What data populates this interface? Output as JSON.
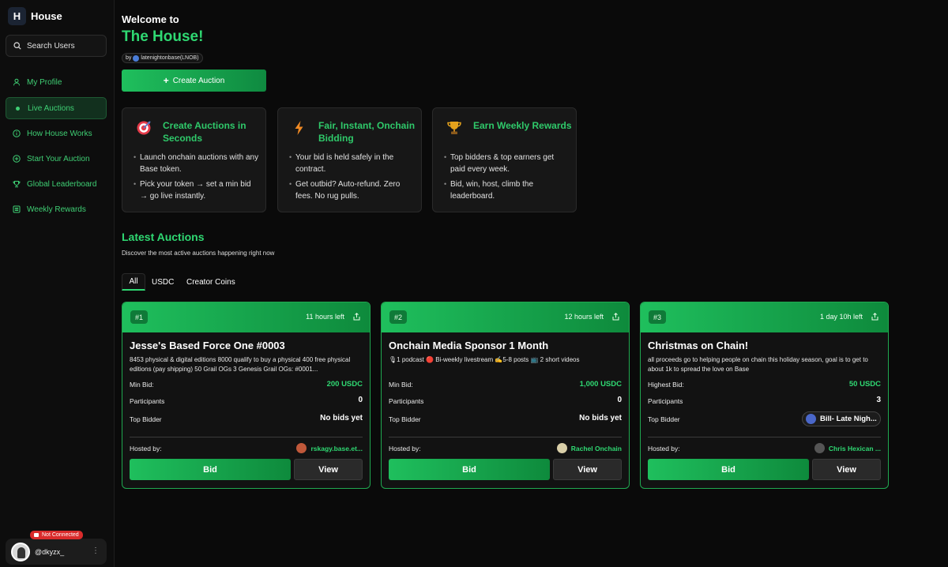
{
  "app": {
    "logo_letter": "H",
    "name": "House"
  },
  "sidebar": {
    "search_label": "Search Users",
    "items": [
      {
        "label": "My Profile",
        "icon": "user-icon"
      },
      {
        "label": "Live Auctions",
        "icon": "live-dot-icon",
        "active": true
      },
      {
        "label": "How House Works",
        "icon": "info-icon"
      },
      {
        "label": "Start Your Auction",
        "icon": "plus-circle-icon"
      },
      {
        "label": "Global Leaderboard",
        "icon": "trophy-icon"
      },
      {
        "label": "Weekly Rewards",
        "icon": "list-icon"
      }
    ],
    "status_badge": "Not Connected",
    "user_handle": "@dkyzx_"
  },
  "hero": {
    "welcome": "Welcome to",
    "title": "The House!",
    "by_prefix": "by",
    "by_name": "latenightonbase(LNOB)",
    "create_button": "Create Auction"
  },
  "features": [
    {
      "icon": "target-icon",
      "title": "Create Auctions in Seconds",
      "bullets": [
        "Launch onchain auctions with any Base token.",
        "Pick your token → set a min bid → go live instantly."
      ]
    },
    {
      "icon": "lightning-icon",
      "title": "Fair, Instant, Onchain Bidding",
      "bullets": [
        "Your bid is held safely in the contract.",
        "Get outbid? Auto-refund. Zero fees. No rug pulls."
      ]
    },
    {
      "icon": "trophy-icon",
      "title": "Earn Weekly Rewards",
      "bullets": [
        "Top bidders & top earners get paid every week.",
        "Bid, win, host, climb the leaderboard."
      ]
    }
  ],
  "latest": {
    "title": "Latest Auctions",
    "subtitle": "Discover the most active auctions happening right now",
    "tabs": [
      "All",
      "USDC",
      "Creator Coins"
    ]
  },
  "labels": {
    "participants": "Participants",
    "top_bidder": "Top Bidder",
    "hosted_by": "Hosted by:",
    "bid": "Bid",
    "view": "View"
  },
  "auctions": [
    {
      "rank": "#1",
      "time_left": "11 hours left",
      "title": "Jesse's Based Force One #0003",
      "description": "8453 physical & digital editions 8000 qualify to buy a physical 400 free physical editions (pay shipping) 50 Grail OGs 3 Genesis Grail OGs: #0001...",
      "bid_label": "Min Bid:",
      "bid_value": "200 USDC",
      "participants": "0",
      "top_bidder": "No bids yet",
      "host": "rskagy.base.et..."
    },
    {
      "rank": "#2",
      "time_left": "12 hours left",
      "title": "Onchain Media Sponsor 1 Month",
      "description": "🎙1 podcast 🔴 Bi-weekly livestream ✍️5-8 posts 📺 2 short videos",
      "bid_label": "Min Bid:",
      "bid_value": "1,000 USDC",
      "participants": "0",
      "top_bidder": "No bids yet",
      "host": "Rachel Onchain"
    },
    {
      "rank": "#3",
      "time_left": "1 day 10h left",
      "title": "Christmas on Chain!",
      "description": "all proceeds go to helping people on chain this holiday season, goal is to get to about 1k to spread the love on Base",
      "bid_label": "Highest Bid:",
      "bid_value": "50 USDC",
      "participants": "3",
      "top_bidder": "Bill- Late Nigh...",
      "host": "Chris Hexican ..."
    }
  ],
  "colors": {
    "accent": "#2fd872",
    "background": "#0a0a0a",
    "card": "#171717"
  }
}
